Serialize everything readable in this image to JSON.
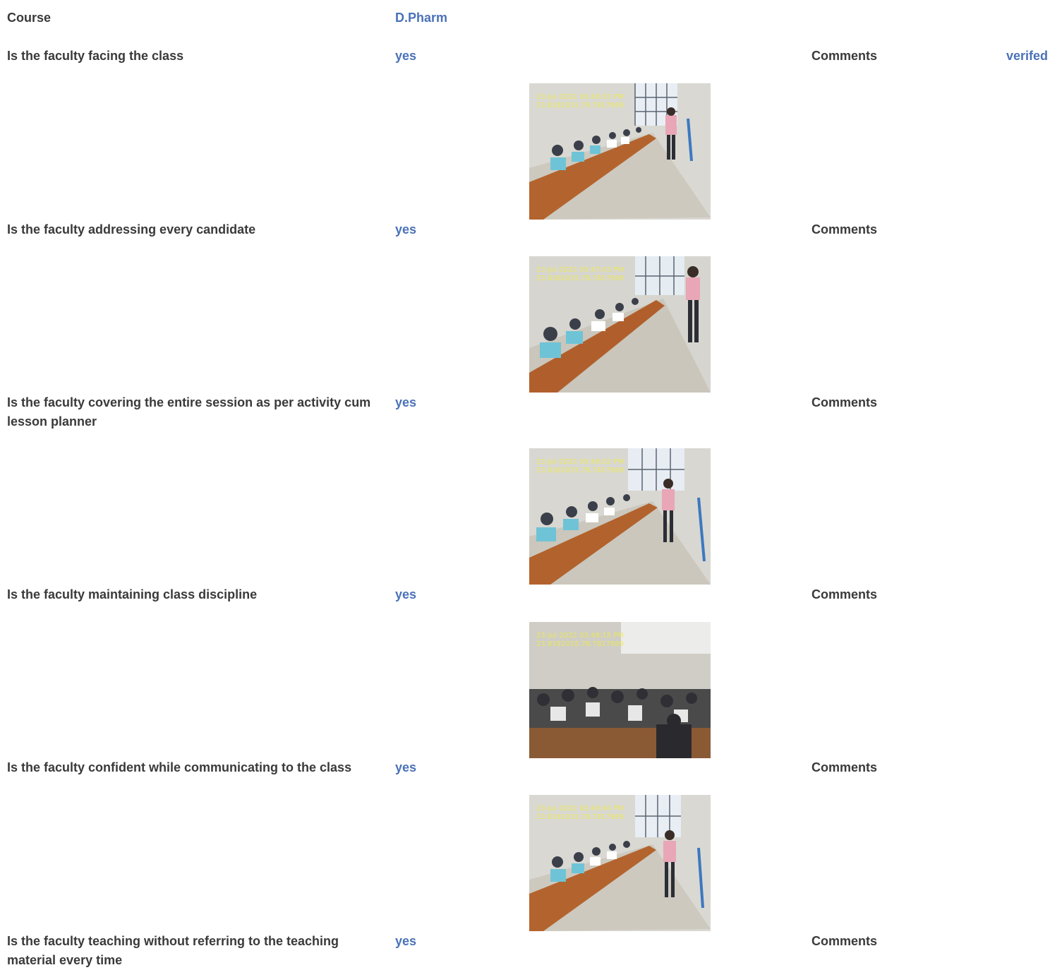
{
  "course": {
    "label": "Course",
    "value": "D.Pharm"
  },
  "status_label": "verifed",
  "comments_label": "Comments",
  "questions": [
    {
      "label": "Is the faculty facing the class",
      "answer": "yes",
      "photo": {
        "stamp_line1": "23-Jul-2022 03:46:52 PM",
        "stamp_line2": "23.8182015,78.7817989"
      }
    },
    {
      "label": "Is the faculty addressing every candidate",
      "answer": "yes",
      "photo": {
        "stamp_line1": "23-Jul-2022 03:47:03 PM",
        "stamp_line2": "23.8182015,78.7817989"
      }
    },
    {
      "label": "Is the faculty covering the entire session as per activity cum lesson planner",
      "answer": "yes",
      "photo": {
        "stamp_line1": "23-Jul-2022 03:48:02 PM",
        "stamp_line2": "23.8182015,78.7817989"
      }
    },
    {
      "label": "Is the faculty maintaining class discipline",
      "answer": "yes",
      "photo": {
        "stamp_line1": "23-Jul-2022 03:48:15 PM",
        "stamp_line2": "23.8182015,78.7817989"
      }
    },
    {
      "label": "Is the faculty confident while communicating to the class",
      "answer": "yes",
      "photo": {
        "stamp_line1": "23-Jul-2022 03:48:40 PM",
        "stamp_line2": "23.8182015,78.7817989"
      }
    },
    {
      "label": "Is the faculty teaching without referring to the teaching material every time",
      "answer": "yes"
    }
  ],
  "colors": {
    "label_text": "#3a3a3a",
    "value_text": "#4a72b8",
    "stamp_text": "#f3ef3a"
  }
}
